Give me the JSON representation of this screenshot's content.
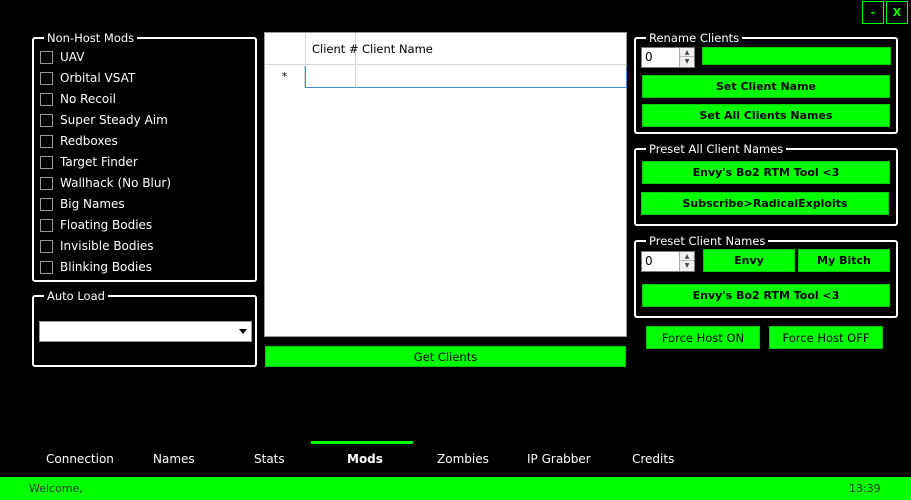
{
  "window": {
    "minimize_label": "-",
    "close_label": "X"
  },
  "nonhost": {
    "title": "Non-Host Mods",
    "items": [
      "UAV",
      "Orbital VSAT",
      "No Recoil",
      "Super Steady Aim",
      "Redboxes",
      "Target Finder",
      "Wallhack (No Blur)",
      "Big Names",
      "Floating Bodies",
      "Invisible Bodies",
      "Blinking Bodies"
    ]
  },
  "autoload": {
    "title": "Auto Load",
    "value": ""
  },
  "grid": {
    "col1": "Client #",
    "col2": "Client Name",
    "newrow_marker": "*"
  },
  "get_clients": "Get Clients",
  "rename": {
    "title": "Rename Clients",
    "spinner_value": "0",
    "name_value": "",
    "set_name": "Set Client Name",
    "set_all": "Set All Clients Names"
  },
  "preset_all": {
    "title": "Preset All Client Names",
    "btn1": "Envy's Bo2 RTM Tool <3",
    "btn2": "Subscribe>RadicalExploits"
  },
  "preset_client": {
    "title": "Preset Client Names",
    "spinner_value": "0",
    "envy": "Envy",
    "mybitch": "My Bitch",
    "tool": "Envy's Bo2 RTM Tool <3"
  },
  "force_on": "Force Host ON",
  "force_off": "Force Host OFF",
  "tabs": [
    "Connection",
    "Names",
    "Stats",
    "Mods",
    "Zombies",
    "IP Grabber",
    "Credits"
  ],
  "active_tab": "Mods",
  "status": {
    "message": "Welcome,",
    "time": "13:39"
  },
  "colors": {
    "accent": "#00ff00",
    "background": "#000000"
  }
}
